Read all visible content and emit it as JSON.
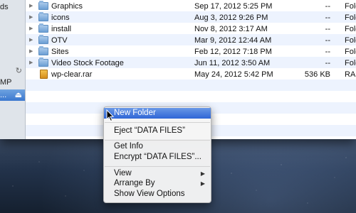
{
  "sidebar": {
    "items": [
      {
        "label": "ds",
        "icon": "",
        "selected": false
      },
      {
        "label": "",
        "icon": "sync-icon",
        "selected": false
      },
      {
        "label": "MP",
        "icon": "",
        "selected": false
      },
      {
        "label": "...",
        "icon": "eject-icon",
        "selected": true
      }
    ],
    "sync_glyph": "↻",
    "eject_glyph": "⏏"
  },
  "file_list": {
    "rows": [
      {
        "name": "Graphics",
        "date": "Sep 17, 2012 5:25 PM",
        "size": "--",
        "kind": "Fold",
        "type": "folder"
      },
      {
        "name": "icons",
        "date": "Aug 3, 2012 9:26 PM",
        "size": "--",
        "kind": "Fold",
        "type": "folder"
      },
      {
        "name": "install",
        "date": "Nov 8, 2012 3:17 AM",
        "size": "--",
        "kind": "Fold",
        "type": "folder"
      },
      {
        "name": "OTV",
        "date": "Mar 9, 2012 12:44 AM",
        "size": "--",
        "kind": "Fold",
        "type": "folder"
      },
      {
        "name": "Sites",
        "date": "Feb 12, 2012 7:18 PM",
        "size": "--",
        "kind": "Fold",
        "type": "folder"
      },
      {
        "name": "Video Stock Footage",
        "date": "Jun 11, 2012 3:50 AM",
        "size": "--",
        "kind": "Fold",
        "type": "folder"
      },
      {
        "name": "wp-clear.rar",
        "date": "May 24, 2012 5:42 PM",
        "size": "536 KB",
        "kind": "RAR",
        "type": "rar"
      }
    ]
  },
  "context_menu": {
    "new_folder": "New Folder",
    "eject": "Eject “DATA FILES”",
    "get_info": "Get Info",
    "encrypt": "Encrypt “DATA FILES”...",
    "view": "View",
    "arrange_by": "Arrange By",
    "show_view_options": "Show View Options",
    "submenu_glyph": "▶"
  },
  "colors": {
    "highlight": "#3b6fd8",
    "sidebar_selected": "#3b78cf",
    "row_alt": "#edf3fe"
  }
}
